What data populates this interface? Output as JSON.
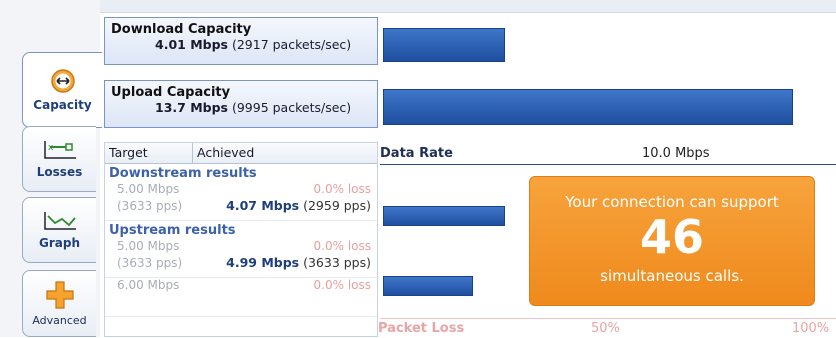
{
  "tabs": [
    {
      "label": "Capacity",
      "icon": "double-arrow-icon",
      "active": true
    },
    {
      "label": "Losses",
      "icon": "losses-chart-icon",
      "active": false
    },
    {
      "label": "Graph",
      "icon": "line-graph-icon",
      "active": false
    },
    {
      "label": "Advanced",
      "icon": "plus-icon",
      "active": false
    }
  ],
  "download": {
    "title": "Download Capacity",
    "rate": "4.01 Mbps",
    "packets": "(2917 packets/sec)",
    "bar_fraction": 0.27
  },
  "upload": {
    "title": "Upload Capacity",
    "rate": "13.7 Mbps",
    "packets": "(9995 packets/sec)",
    "bar_fraction": 0.91
  },
  "results": {
    "headers": [
      "Target",
      "Achieved"
    ],
    "downstream_title": "Downstream results",
    "upstream_title": "Upstream results",
    "downstream": [
      {
        "target_rate": "5.00 Mbps",
        "target_pps": "(3633 pps)",
        "loss": "0.0% loss",
        "achieved_rate": "4.07 Mbps",
        "achieved_pps": "(2959 pps)",
        "bar_fraction": 0.27
      }
    ],
    "upstream": [
      {
        "target_rate": "5.00 Mbps",
        "target_pps": "(3633 pps)",
        "loss": "0.0% loss",
        "achieved_rate": "4.99 Mbps",
        "achieved_pps": "(3633 pps)",
        "bar_fraction": 0.2
      },
      {
        "target_rate": "6.00 Mbps",
        "target_pps": "",
        "loss": "0.0% loss",
        "achieved_rate": "",
        "achieved_pps": ""
      }
    ]
  },
  "axis": {
    "data_rate_label": "Data Rate",
    "data_rate_tick": "10.0 Mbps",
    "packet_loss_label": "Packet Loss",
    "loss_tick_mid": "50%",
    "loss_tick_end": "100%"
  },
  "callout": {
    "line1": "Your connection can support",
    "number": "46",
    "line3": "simultaneous calls."
  },
  "colors": {
    "bar": "#2a5db0",
    "accent_orange": "#f29a2e",
    "section_blue": "#3d62a8"
  }
}
